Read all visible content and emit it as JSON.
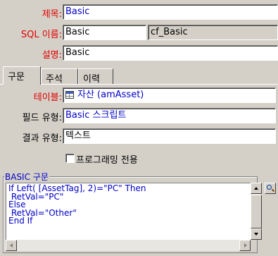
{
  "form": {
    "title_label": "제목:",
    "title_value": "Basic",
    "sql_name_label": "SQL 이름:",
    "sql_name_value": "Basic",
    "sql_name_id": "cf_Basic",
    "description_label": "설명:",
    "description_value": "Basic"
  },
  "tabs": [
    {
      "label": "구문",
      "active": true
    },
    {
      "label": "주석",
      "active": false
    },
    {
      "label": "이력",
      "active": false
    }
  ],
  "syntax": {
    "table_label": "테이블:",
    "table_value": "자산 (amAsset)",
    "field_type_label": "필드 유형:",
    "field_type_value": "Basic 스크립트",
    "result_type_label": "결과 유형:",
    "result_type_value": "텍스트",
    "programming_checkbox_label": "프로그래밍 전용",
    "programming_checked": false,
    "group_label": "BASIC 구문",
    "code": "If Left( [AssetTag], 2)=\"PC\" Then\n RetVal=\"PC\"\nElse\n RetVal=\"Other\"\nEnd If"
  },
  "colors": {
    "background": "#d4d0c8",
    "label_red": "#e00000",
    "value_blue": "#0000c8"
  },
  "icons": [
    "table-icon",
    "search-icon",
    "dropdown-arrow-icon"
  ]
}
